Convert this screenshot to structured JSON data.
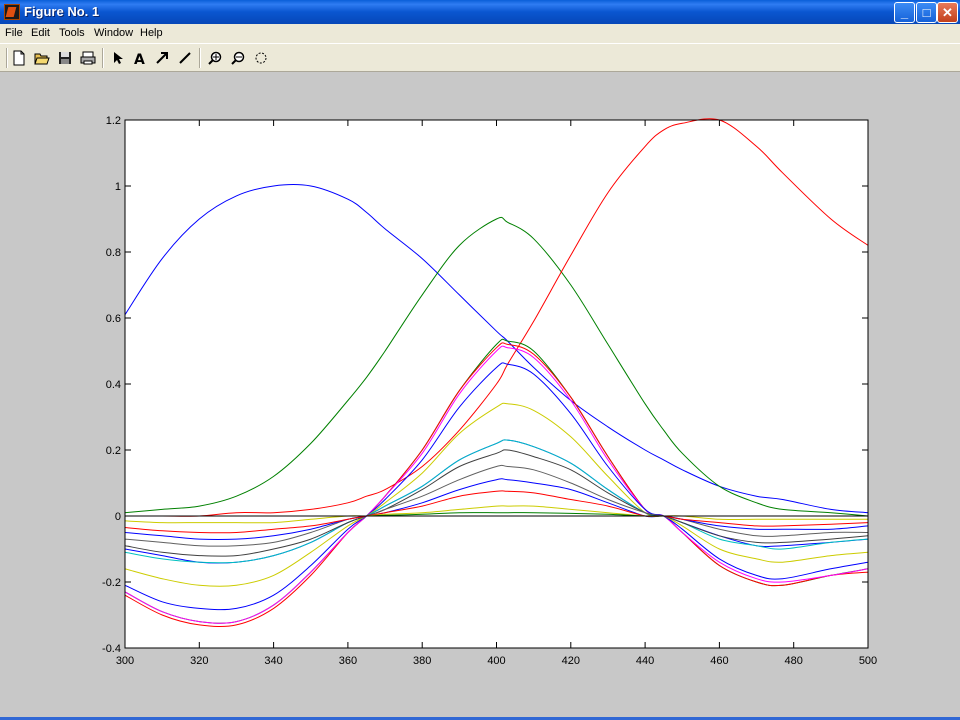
{
  "window": {
    "title": "Figure No. 1",
    "minimize": "_",
    "maximize": "□",
    "close": "✕"
  },
  "menu": {
    "items": [
      "File",
      "Edit",
      "Tools",
      "Window",
      "Help"
    ]
  },
  "toolbar": {
    "icons": [
      "new-figure-icon",
      "open-icon",
      "save-icon",
      "print-icon",
      "select-arrow-icon",
      "insert-text-icon",
      "insert-arrow-icon",
      "insert-line-icon",
      "zoom-in-icon",
      "zoom-out-icon",
      "rotate-3d-icon"
    ]
  },
  "chart_data": {
    "type": "line",
    "title": "",
    "xlabel": "",
    "ylabel": "",
    "xlim": [
      300,
      500
    ],
    "ylim": [
      -0.4,
      1.2
    ],
    "x_ticks": [
      300,
      320,
      340,
      360,
      380,
      400,
      420,
      440,
      460,
      480,
      500
    ],
    "y_ticks": [
      -0.4,
      -0.2,
      0,
      0.2,
      0.4,
      0.6,
      0.8,
      1,
      1.2
    ],
    "x_tick_labels": [
      "300",
      "320",
      "340",
      "360",
      "380",
      "400",
      "420",
      "440",
      "460",
      "480",
      "500"
    ],
    "y_tick_labels": [
      "-0.4",
      "-0.2",
      "0",
      "0.2",
      "0.4",
      "0.6",
      "0.8",
      "1",
      "1.2"
    ],
    "grid": false,
    "legend": "none",
    "x": [
      300,
      310,
      320,
      330,
      340,
      350,
      360,
      365,
      370,
      380,
      390,
      400,
      403,
      410,
      420,
      430,
      440,
      445,
      450,
      460,
      470,
      477,
      490,
      500
    ],
    "series": [
      {
        "color": "#0000ff",
        "values": [
          0.61,
          0.78,
          0.9,
          0.97,
          1.0,
          1.0,
          0.96,
          0.92,
          0.87,
          0.78,
          0.67,
          0.56,
          0.53,
          0.45,
          0.35,
          0.27,
          0.2,
          0.17,
          0.14,
          0.09,
          0.06,
          0.05,
          0.02,
          0.01
        ]
      },
      {
        "color": "#008000",
        "values": [
          0.01,
          0.02,
          0.03,
          0.06,
          0.12,
          0.22,
          0.35,
          0.42,
          0.5,
          0.67,
          0.82,
          0.9,
          0.89,
          0.84,
          0.7,
          0.52,
          0.34,
          0.26,
          0.19,
          0.09,
          0.04,
          0.02,
          0.01,
          0.0
        ]
      },
      {
        "color": "#ff0000",
        "values": [
          0.0,
          0.0,
          0.0,
          0.01,
          0.01,
          0.02,
          0.04,
          0.06,
          0.08,
          0.15,
          0.26,
          0.4,
          0.46,
          0.59,
          0.79,
          0.98,
          1.12,
          1.17,
          1.19,
          1.2,
          1.12,
          1.04,
          0.9,
          0.82
        ]
      },
      {
        "color": "#008000",
        "values": [
          -0.23,
          -0.29,
          -0.32,
          -0.32,
          -0.27,
          -0.17,
          -0.05,
          0.0,
          0.06,
          0.2,
          0.38,
          0.52,
          0.53,
          0.5,
          0.36,
          0.18,
          0.02,
          0.0,
          -0.05,
          -0.15,
          -0.2,
          -0.21,
          -0.18,
          -0.16
        ]
      },
      {
        "color": "#ff0000",
        "values": [
          -0.24,
          -0.3,
          -0.33,
          -0.33,
          -0.28,
          -0.18,
          -0.05,
          0.0,
          0.06,
          0.2,
          0.38,
          0.51,
          0.52,
          0.49,
          0.36,
          0.18,
          0.02,
          0.0,
          -0.05,
          -0.15,
          -0.2,
          -0.21,
          -0.18,
          -0.17
        ]
      },
      {
        "color": "#ff00ff",
        "values": [
          -0.23,
          -0.29,
          -0.32,
          -0.32,
          -0.27,
          -0.17,
          -0.05,
          0.0,
          0.06,
          0.19,
          0.37,
          0.5,
          0.51,
          0.48,
          0.35,
          0.17,
          0.02,
          0.0,
          -0.05,
          -0.14,
          -0.19,
          -0.2,
          -0.18,
          -0.16
        ]
      },
      {
        "color": "#0000ff",
        "values": [
          -0.21,
          -0.26,
          -0.28,
          -0.28,
          -0.24,
          -0.15,
          -0.04,
          0.0,
          0.05,
          0.17,
          0.33,
          0.45,
          0.46,
          0.43,
          0.31,
          0.15,
          0.02,
          0.0,
          -0.04,
          -0.13,
          -0.18,
          -0.19,
          -0.16,
          -0.14
        ]
      },
      {
        "color": "#cccc00",
        "values": [
          -0.16,
          -0.19,
          -0.21,
          -0.21,
          -0.18,
          -0.11,
          -0.03,
          0.0,
          0.04,
          0.13,
          0.25,
          0.33,
          0.34,
          0.32,
          0.24,
          0.12,
          0.01,
          0.0,
          -0.03,
          -0.1,
          -0.13,
          -0.14,
          -0.12,
          -0.11
        ]
      },
      {
        "color": "#0000ff",
        "values": [
          -0.1,
          -0.12,
          -0.14,
          -0.14,
          -0.12,
          -0.08,
          -0.02,
          0.0,
          0.03,
          0.09,
          0.17,
          0.22,
          0.23,
          0.21,
          0.16,
          0.08,
          0.01,
          0.0,
          -0.02,
          -0.06,
          -0.09,
          -0.09,
          -0.08,
          -0.07
        ]
      },
      {
        "color": "#00c0c0",
        "values": [
          -0.11,
          -0.13,
          -0.14,
          -0.14,
          -0.12,
          -0.08,
          -0.02,
          0.0,
          0.03,
          0.09,
          0.17,
          0.22,
          0.23,
          0.21,
          0.16,
          0.08,
          0.01,
          0.0,
          -0.02,
          -0.07,
          -0.09,
          -0.1,
          -0.08,
          -0.07
        ]
      },
      {
        "color": "#404040",
        "values": [
          -0.09,
          -0.11,
          -0.12,
          -0.12,
          -0.1,
          -0.07,
          -0.02,
          0.0,
          0.02,
          0.08,
          0.15,
          0.19,
          0.2,
          0.18,
          0.14,
          0.07,
          0.01,
          0.0,
          -0.02,
          -0.06,
          -0.08,
          -0.08,
          -0.07,
          -0.06
        ]
      },
      {
        "color": "#606060",
        "values": [
          -0.07,
          -0.08,
          -0.09,
          -0.09,
          -0.08,
          -0.05,
          -0.01,
          0.0,
          0.02,
          0.06,
          0.11,
          0.15,
          0.15,
          0.14,
          0.1,
          0.05,
          0.01,
          0.0,
          -0.01,
          -0.04,
          -0.06,
          -0.06,
          -0.05,
          -0.05
        ]
      },
      {
        "color": "#0000ff",
        "values": [
          -0.05,
          -0.06,
          -0.07,
          -0.07,
          -0.06,
          -0.04,
          -0.01,
          0.0,
          0.01,
          0.04,
          0.08,
          0.11,
          0.11,
          0.1,
          0.08,
          0.04,
          0.0,
          0.0,
          -0.01,
          -0.03,
          -0.04,
          -0.04,
          -0.04,
          -0.03
        ]
      },
      {
        "color": "#ff0000",
        "values": [
          -0.035,
          -0.045,
          -0.05,
          -0.05,
          -0.04,
          -0.03,
          -0.01,
          0.0,
          0.01,
          0.03,
          0.06,
          0.075,
          0.075,
          0.07,
          0.05,
          0.03,
          0.0,
          0.0,
          -0.01,
          -0.02,
          -0.03,
          -0.03,
          -0.025,
          -0.02
        ]
      },
      {
        "color": "#cccc00",
        "values": [
          -0.015,
          -0.02,
          -0.02,
          -0.02,
          -0.02,
          -0.01,
          0.0,
          0.0,
          0.005,
          0.01,
          0.02,
          0.03,
          0.03,
          0.03,
          0.02,
          0.01,
          0.0,
          0.0,
          0.0,
          -0.01,
          -0.01,
          -0.01,
          -0.01,
          -0.01
        ]
      },
      {
        "color": "#008000",
        "values": [
          0.0,
          0.0,
          0.0,
          0.0,
          0.0,
          0.0,
          0.0,
          0.0,
          0.002,
          0.005,
          0.01,
          0.01,
          0.01,
          0.01,
          0.008,
          0.005,
          0.0,
          0.0,
          0.0,
          0.0,
          0.0,
          0.0,
          0.0,
          0.0
        ]
      },
      {
        "color": "#000000",
        "values": [
          0.0,
          0.0,
          0.0,
          0.0,
          0.0,
          0.0,
          0.0,
          0.0,
          0.0,
          0.0,
          0.0,
          0.0,
          0.0,
          0.0,
          0.0,
          0.0,
          0.0,
          0.0,
          0.0,
          0.0,
          0.0,
          0.0,
          0.0,
          0.0
        ]
      }
    ]
  }
}
